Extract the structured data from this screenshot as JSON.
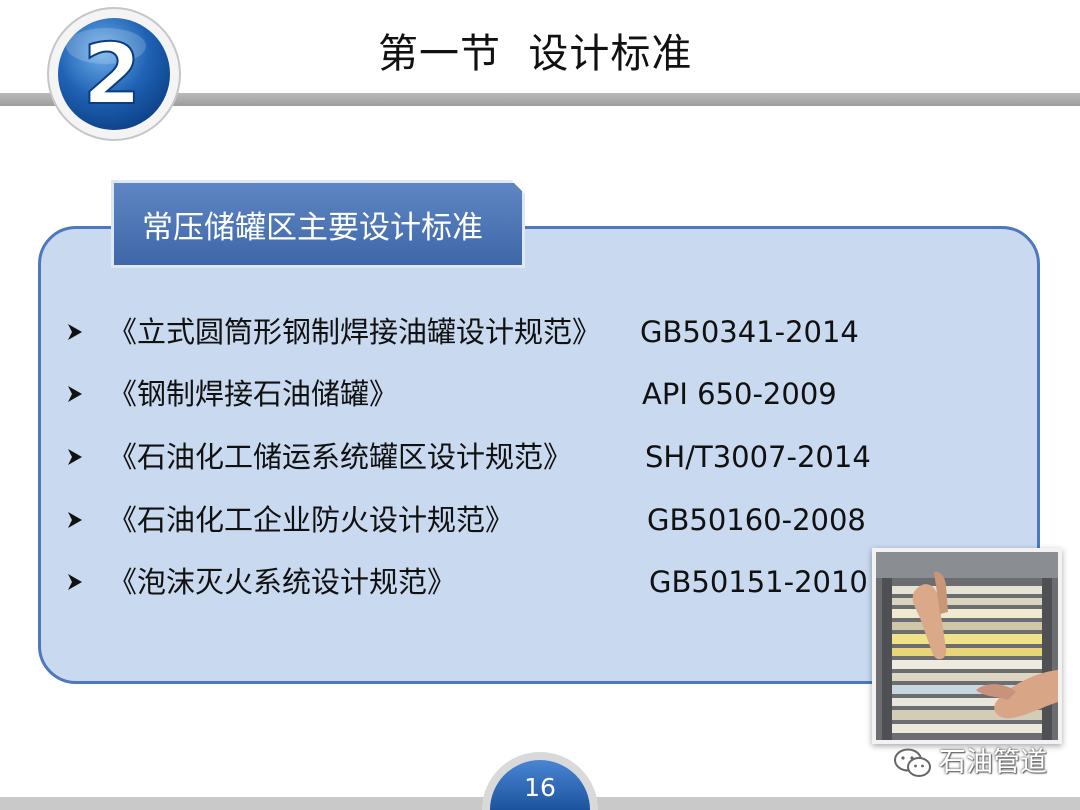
{
  "header": {
    "section_number": "2",
    "title": "第一节  设计标准"
  },
  "panel": {
    "tab_label": "常压储罐区主要设计标准",
    "standards": [
      {
        "name": "《立式圆筒形钢制焊接油罐设计规范》",
        "code": "GB50341-2014"
      },
      {
        "name": "《钢制焊接石油储罐》",
        "code": "API 650-2009"
      },
      {
        "name": "《石油化工储运系统罐区设计规范》",
        "code": "SH/T3007-2014"
      },
      {
        "name": "《石油化工企业防火设计规范》",
        "code": "GB50160-2008"
      },
      {
        "name": "《泡沫灭火系统设计规范》",
        "code": "GB50151-2010"
      }
    ]
  },
  "watermark": {
    "text": "石油管道"
  },
  "footer": {
    "page_number": "16"
  },
  "colors": {
    "accent_blue": "#4d78bf",
    "panel_fill": "#c9d9f0",
    "badge_blue": "#1f5fae"
  },
  "icons": {
    "bullet": "arrowhead-bullet-icon",
    "watermark": "wechat-icon"
  }
}
